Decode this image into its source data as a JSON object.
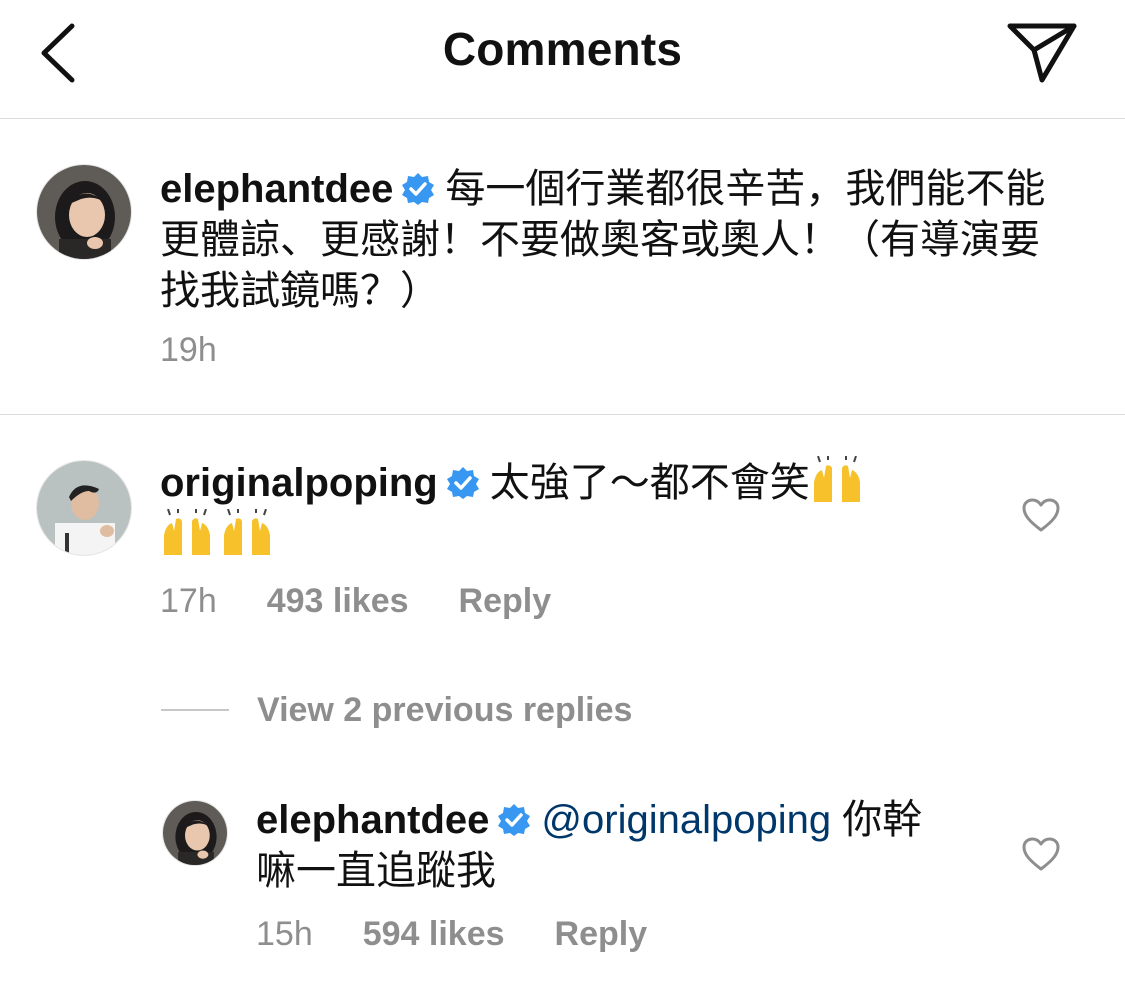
{
  "header": {
    "title": "Comments",
    "back_icon": "chevron-left-icon",
    "share_icon": "paper-plane-icon"
  },
  "caption": {
    "username": "elephantdee",
    "text": "每一個行業都很辛苦，我們能不能更體諒、更感謝！不要做奧客或奧人！（有導演要找我試鏡嗎？）",
    "time": "19h"
  },
  "comments": [
    {
      "username": "originalpoping",
      "text": "太強了～都不會笑",
      "time": "17h",
      "likes": "493 likes",
      "reply": "Reply"
    }
  ],
  "view_replies": "View 2 previous replies",
  "replies": [
    {
      "username": "elephantdee",
      "mention": "@originalpoping",
      "text": "你幹嘛一直追蹤我",
      "time": "15h",
      "likes": "594 likes",
      "reply": "Reply"
    }
  ],
  "colors": {
    "verified": "#3897f0",
    "mention": "#00376b",
    "meta": "#8e8e8e",
    "divider": "#dbdbdb"
  }
}
